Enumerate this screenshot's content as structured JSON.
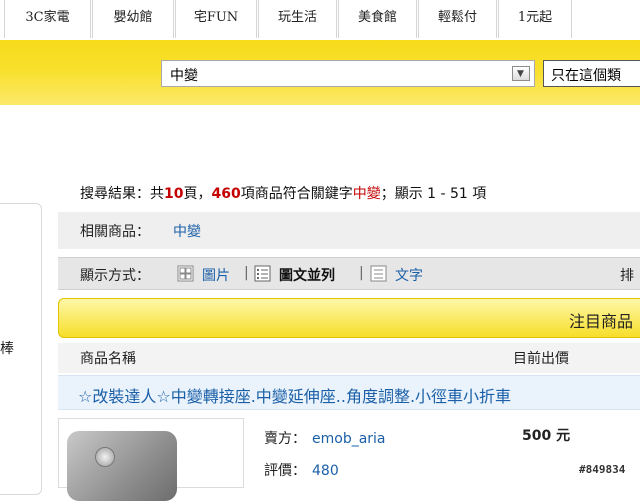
{
  "top_tabs": [
    "3C家電",
    "嬰幼館",
    "宅FUN",
    "玩生活",
    "美食館",
    "輕鬆付",
    "1元起"
  ],
  "search": {
    "value": "中變",
    "scope_label": "只在這個類"
  },
  "summary": {
    "prefix": "搜尋結果：共",
    "pages": "10",
    "pages_unit": "頁，",
    "items": "460",
    "mid": "項商品符合關鍵字",
    "keyword": "中變",
    "suffix": "；顯示 1 - 51 項"
  },
  "related": {
    "label": "相關商品：",
    "link": "中變"
  },
  "display": {
    "label": "顯示方式：",
    "options": [
      "圖片",
      "圖文並列",
      "文字"
    ],
    "separator": "|",
    "sort_label": "排"
  },
  "featured_label": "注目商品",
  "columns": {
    "name": "商品名稱",
    "price": "目前出價"
  },
  "product": {
    "title": "☆改裝達人☆中變轉接座.中變延伸座..角度調整.小徑車小折車",
    "seller_label": "賣方：",
    "seller": "emob_aria",
    "rating_label": "評價：",
    "rating": "480",
    "price": "500 元"
  },
  "left_panel_glyph": "棒",
  "watermark": "#849834",
  "colors": {
    "accent_yellow": "#f7dc1b",
    "link_blue": "#1a5fa8",
    "highlight_red": "#c40000"
  }
}
